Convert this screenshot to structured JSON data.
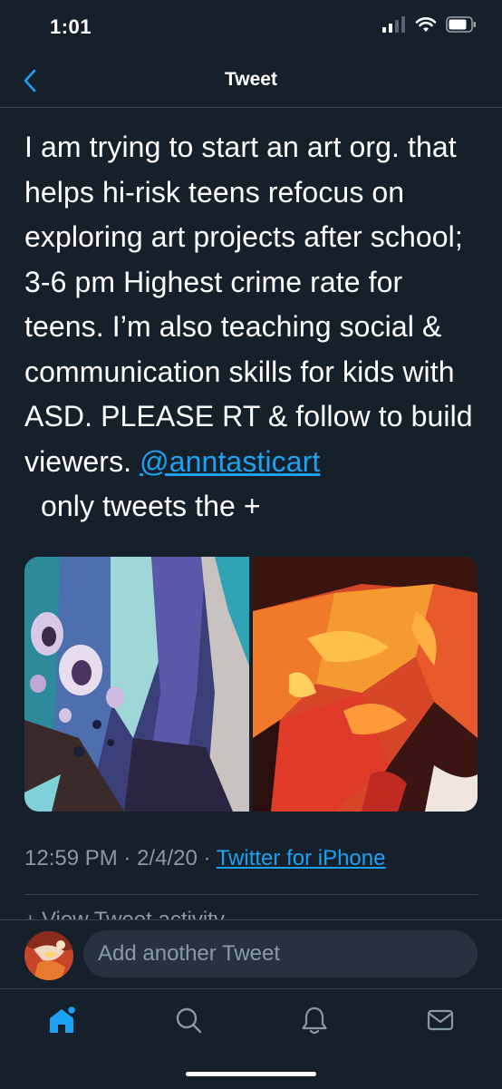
{
  "status_bar": {
    "time": "1:01"
  },
  "header": {
    "title": "Tweet"
  },
  "tweet": {
    "text": "I am trying to start an art org. that helps hi-risk teens refocus on exploring art projects after school; 3-6 pm Highest crime rate for teens. I’m also teaching social & communication skills for kids with ASD. PLEASE RT & follow to build viewers.",
    "mention": "@anntasticart",
    "text_after_mention": "  only tweets the +",
    "time": "12:59 PM",
    "date": "2/4/20",
    "separator": "·",
    "source": "Twitter for iPhone",
    "media": [
      {
        "description_icon": "abstract-pour-art-blue"
      },
      {
        "description_icon": "abstract-pour-art-orange"
      }
    ],
    "activity_label": "View Tweet activity"
  },
  "compose": {
    "placeholder": "Add another Tweet"
  },
  "tabs": [
    {
      "name": "home",
      "icon": "home-icon"
    },
    {
      "name": "search",
      "icon": "search-icon"
    },
    {
      "name": "notifications",
      "icon": "bell-icon"
    },
    {
      "name": "messages",
      "icon": "mail-icon"
    }
  ],
  "colors": {
    "background": "#15202b",
    "accent": "#1da1f2",
    "secondary_text": "#8899a6",
    "divider": "#38444d"
  }
}
